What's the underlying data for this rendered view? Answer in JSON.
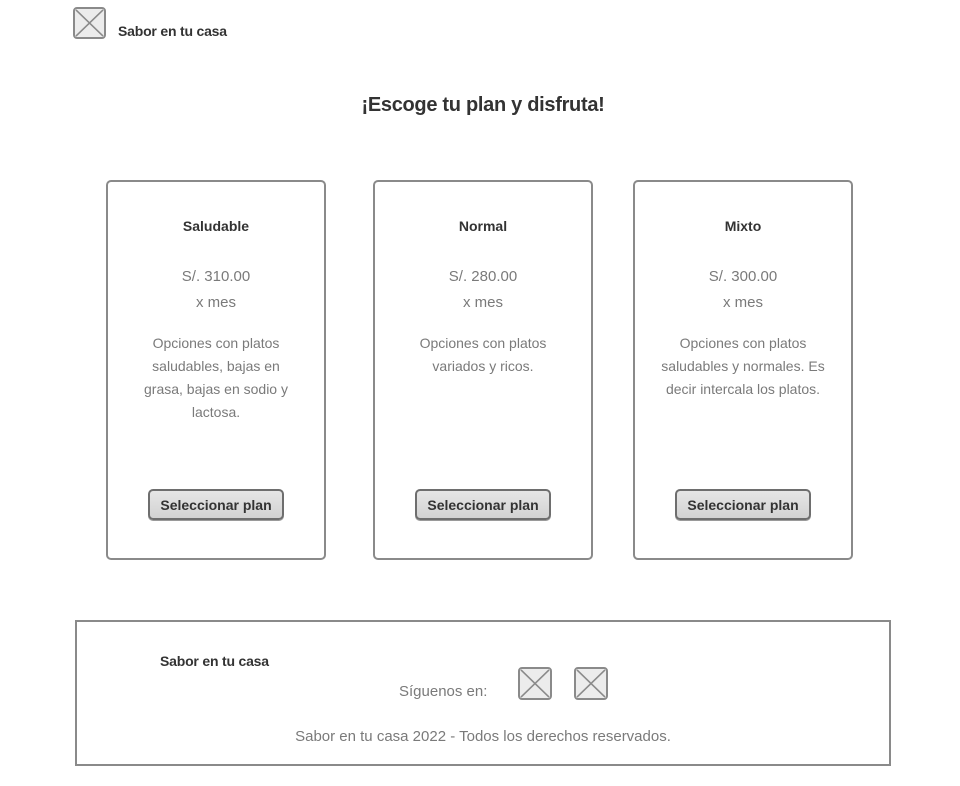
{
  "header": {
    "logo_icon": "image-placeholder-icon",
    "brand": "Sabor en tu casa"
  },
  "main": {
    "title": "¡Escoge tu plan y disfruta!",
    "plans": [
      {
        "name": "Saludable",
        "price": "S/. 310.00",
        "period": "x mes",
        "description": "Opciones con platos saludables, bajas en grasa, bajas en sodio y lactosa.",
        "button_label": "Seleccionar plan"
      },
      {
        "name": "Normal",
        "price": "S/. 280.00",
        "period": "x mes",
        "description": "Opciones con platos variados y ricos.",
        "button_label": "Seleccionar plan"
      },
      {
        "name": "Mixto",
        "price": "S/. 300.00",
        "period": "x mes",
        "description": "Opciones con platos saludables y normales. Es  decir intercala los platos.",
        "button_label": "Seleccionar plan"
      }
    ]
  },
  "footer": {
    "brand": "Sabor en tu casa",
    "follow_label": "Síguenos en:",
    "social_icons": [
      "image-placeholder-icon",
      "image-placeholder-icon"
    ],
    "copyright": "Sabor en tu casa 2022 - Todos los derechos reservados."
  },
  "colors": {
    "border": "#8a8a8a",
    "text_dark": "#333333",
    "text_muted": "#7a7a7a",
    "button_bg": "#dcdcdc"
  }
}
